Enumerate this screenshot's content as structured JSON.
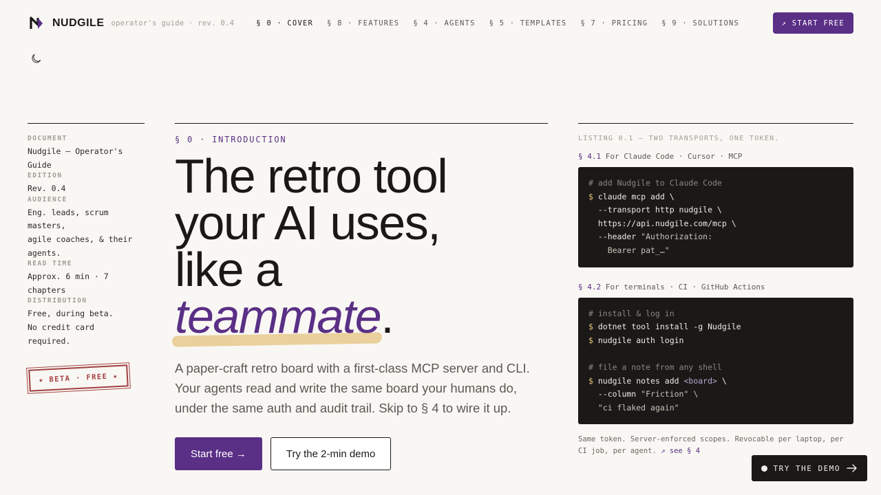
{
  "nav": {
    "brand": "NUDGILE",
    "guide": "operator's guide · rev. 0.4",
    "links": [
      {
        "label": "§ 0 · COVER",
        "active": true
      },
      {
        "label": "§ 8 · FEATURES"
      },
      {
        "label": "§ 4 · AGENTS"
      },
      {
        "label": "§ 5 · TEMPLATES"
      },
      {
        "label": "§ 7 · PRICING"
      },
      {
        "label": "§ 9 · SOLUTIONS"
      }
    ],
    "cta": "↗ START FREE"
  },
  "icons": {
    "logo": "nudgile-logo-icon",
    "theme": "moon-icon",
    "demo": "arrow-right-icon"
  },
  "colors": {
    "accent": "#5a2f86",
    "highlight": "#e9d09c",
    "stamp": "#a04040",
    "code_bg": "#1a1918",
    "background": "#f9f7f3"
  },
  "meta": [
    {
      "label": "DOCUMENT",
      "value": "Nudgile — Operator's\nGuide"
    },
    {
      "label": "EDITION",
      "value": "Rev. 0.4"
    },
    {
      "label": "AUDIENCE",
      "value": "Eng. leads, scrum\nmasters,\nagile coaches, & their\nagents."
    },
    {
      "label": "READ TIME",
      "value": "Approx. 6 min · 7\nchapters"
    },
    {
      "label": "DISTRIBUTION",
      "value": "Free, during beta.\nNo credit card\nrequired."
    }
  ],
  "stamp": "★ BETA · FREE ★",
  "hero": {
    "eyebrow": "§ 0 · INTRODUCTION",
    "line1": "The retro tool",
    "line2": "your AI uses,",
    "line3": "like a",
    "accent": "teammate",
    "dot": ".",
    "lede": "A paper-craft retro board with a first-class MCP server and CLI. Your agents read and write the same board your humans do, under the same auth and audit trail. Skip to § 4 to wire it up.",
    "primary_cta": "Start free →",
    "secondary_cta": "Try the 2-min demo"
  },
  "listing": {
    "title": "LISTING 0.1 — TWO TRANSPORTS, ONE TOKEN.",
    "blocks": [
      {
        "num": "§ 4.1",
        "label": "For Claude Code · Cursor · MCP",
        "lines": [
          {
            "t": "c",
            "text": "# add Nudgile to Claude Code"
          },
          {
            "t": "cmd",
            "prompt": "$ ",
            "text": "claude mcp add \\"
          },
          {
            "t": "plain",
            "text": "  --transport http nudgile \\"
          },
          {
            "t": "plain",
            "text": "  https://api.nudgile.com/mcp \\"
          },
          {
            "t": "str",
            "pre": "  --header ",
            "text": "\"Authorization:"
          },
          {
            "t": "str",
            "pre": "    ",
            "text": "Bearer pat_…\""
          }
        ]
      },
      {
        "num": "§ 4.2",
        "label": "For terminals · CI · GitHub Actions",
        "lines": [
          {
            "t": "c",
            "text": "# install & log in"
          },
          {
            "t": "cmd",
            "prompt": "$ ",
            "text": "dotnet tool install -g Nudgile"
          },
          {
            "t": "cmd",
            "prompt": "$ ",
            "text": "nudgile auth login"
          },
          {
            "t": "plain",
            "text": " "
          },
          {
            "t": "c",
            "text": "# file a note from any shell"
          },
          {
            "t": "arg",
            "prompt": "$ ",
            "text": "nudgile notes add ",
            "arg": "<board>",
            "post": " \\"
          },
          {
            "t": "str",
            "pre": "  --column ",
            "text": "\"Friction\" \\"
          },
          {
            "t": "str",
            "pre": "  ",
            "text": "\"ci flaked again\""
          }
        ]
      }
    ],
    "footnote": "Same token. Server-enforced scopes. Revocable per laptop, per CI job, per agent.",
    "footnote_link": "↗ see § 4"
  },
  "demo_pill": "TRY THE DEMO"
}
